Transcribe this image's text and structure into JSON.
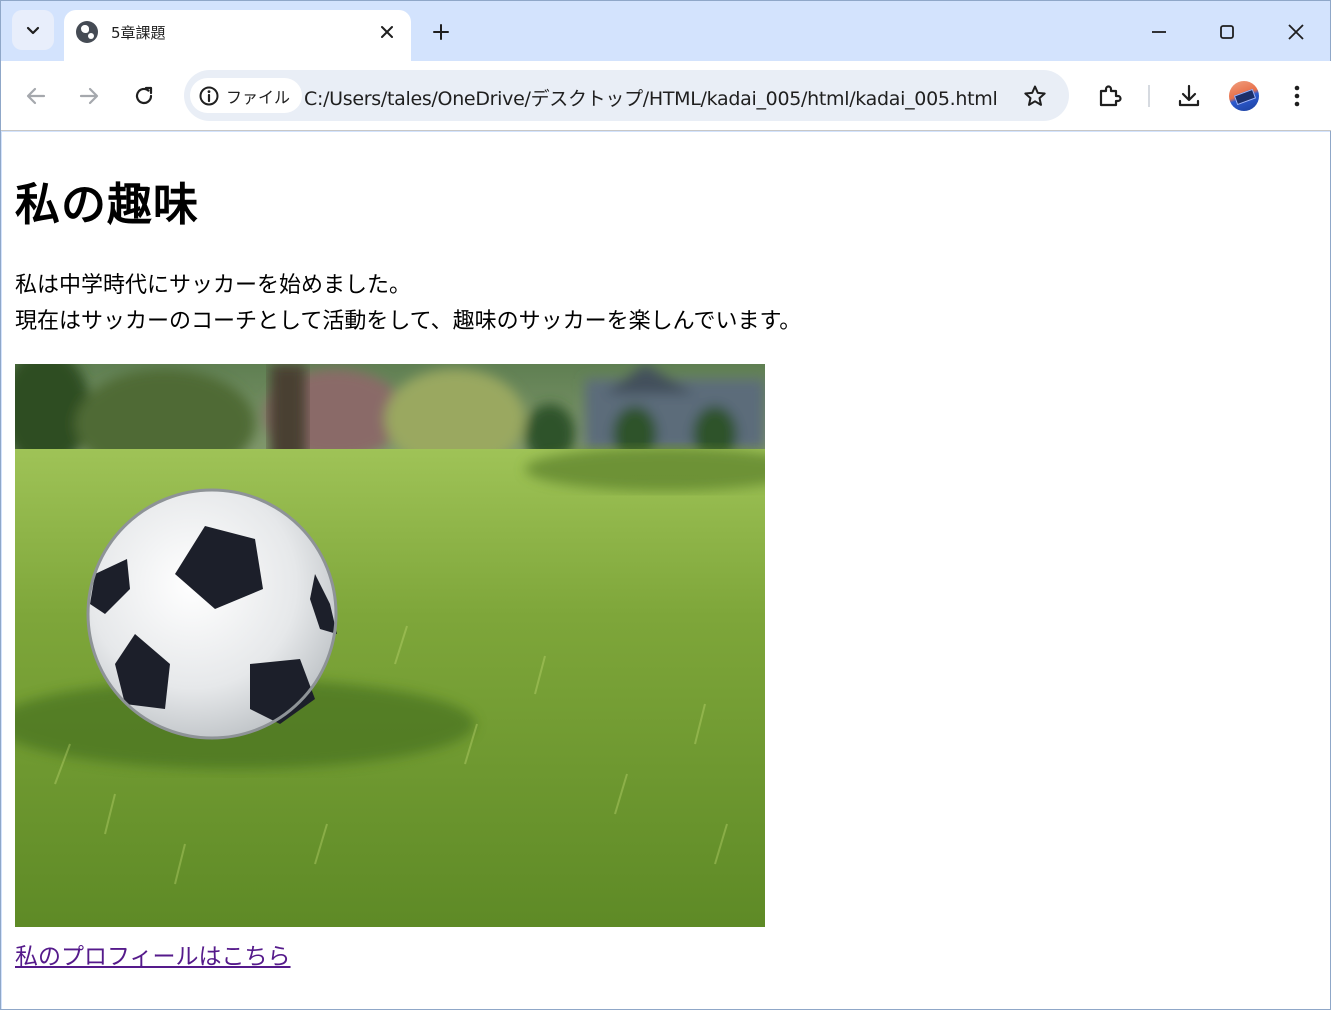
{
  "browser": {
    "tab": {
      "title": "5章課題"
    },
    "address_bar": {
      "security_chip": "ファイル",
      "url": "C:/Users/tales/OneDrive/デスクトップ/HTML/kadai_005/html/kadai_005.html"
    }
  },
  "page": {
    "heading": "私の趣味",
    "paragraph_lines": [
      "私は中学時代にサッカーを始めました。",
      "現在はサッカーのコーチとして活動をして、趣味のサッカーを楽しんでいます。"
    ],
    "link_text": "私のプロフィールはこちら"
  },
  "colors": {
    "tabstrip": "#d3e3fd",
    "omnibox": "#e9eef6",
    "visited_link": "#551a8b"
  }
}
